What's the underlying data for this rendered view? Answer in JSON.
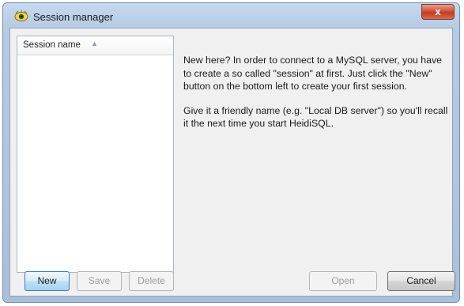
{
  "window": {
    "title": "Session manager",
    "close_label": "x",
    "icon": "heidisql-eye-icon"
  },
  "session_list": {
    "column_header": "Session name",
    "sort_indicator": "^",
    "items": []
  },
  "info": {
    "paragraph1": "New here? In order to connect to a MySQL server, you have to create a so called \"session\" at first. Just click the \"New\" button on the bottom left to create your first session.",
    "paragraph2": "Give it a friendly name (e.g. \"Local DB server\") so you'll recall it the next time you start HeidiSQL."
  },
  "buttons": {
    "new": "New",
    "save": "Save",
    "delete": "Delete",
    "open": "Open",
    "cancel": "Cancel"
  },
  "colors": {
    "accent": "#3c7fb1",
    "close": "#c23c22"
  }
}
